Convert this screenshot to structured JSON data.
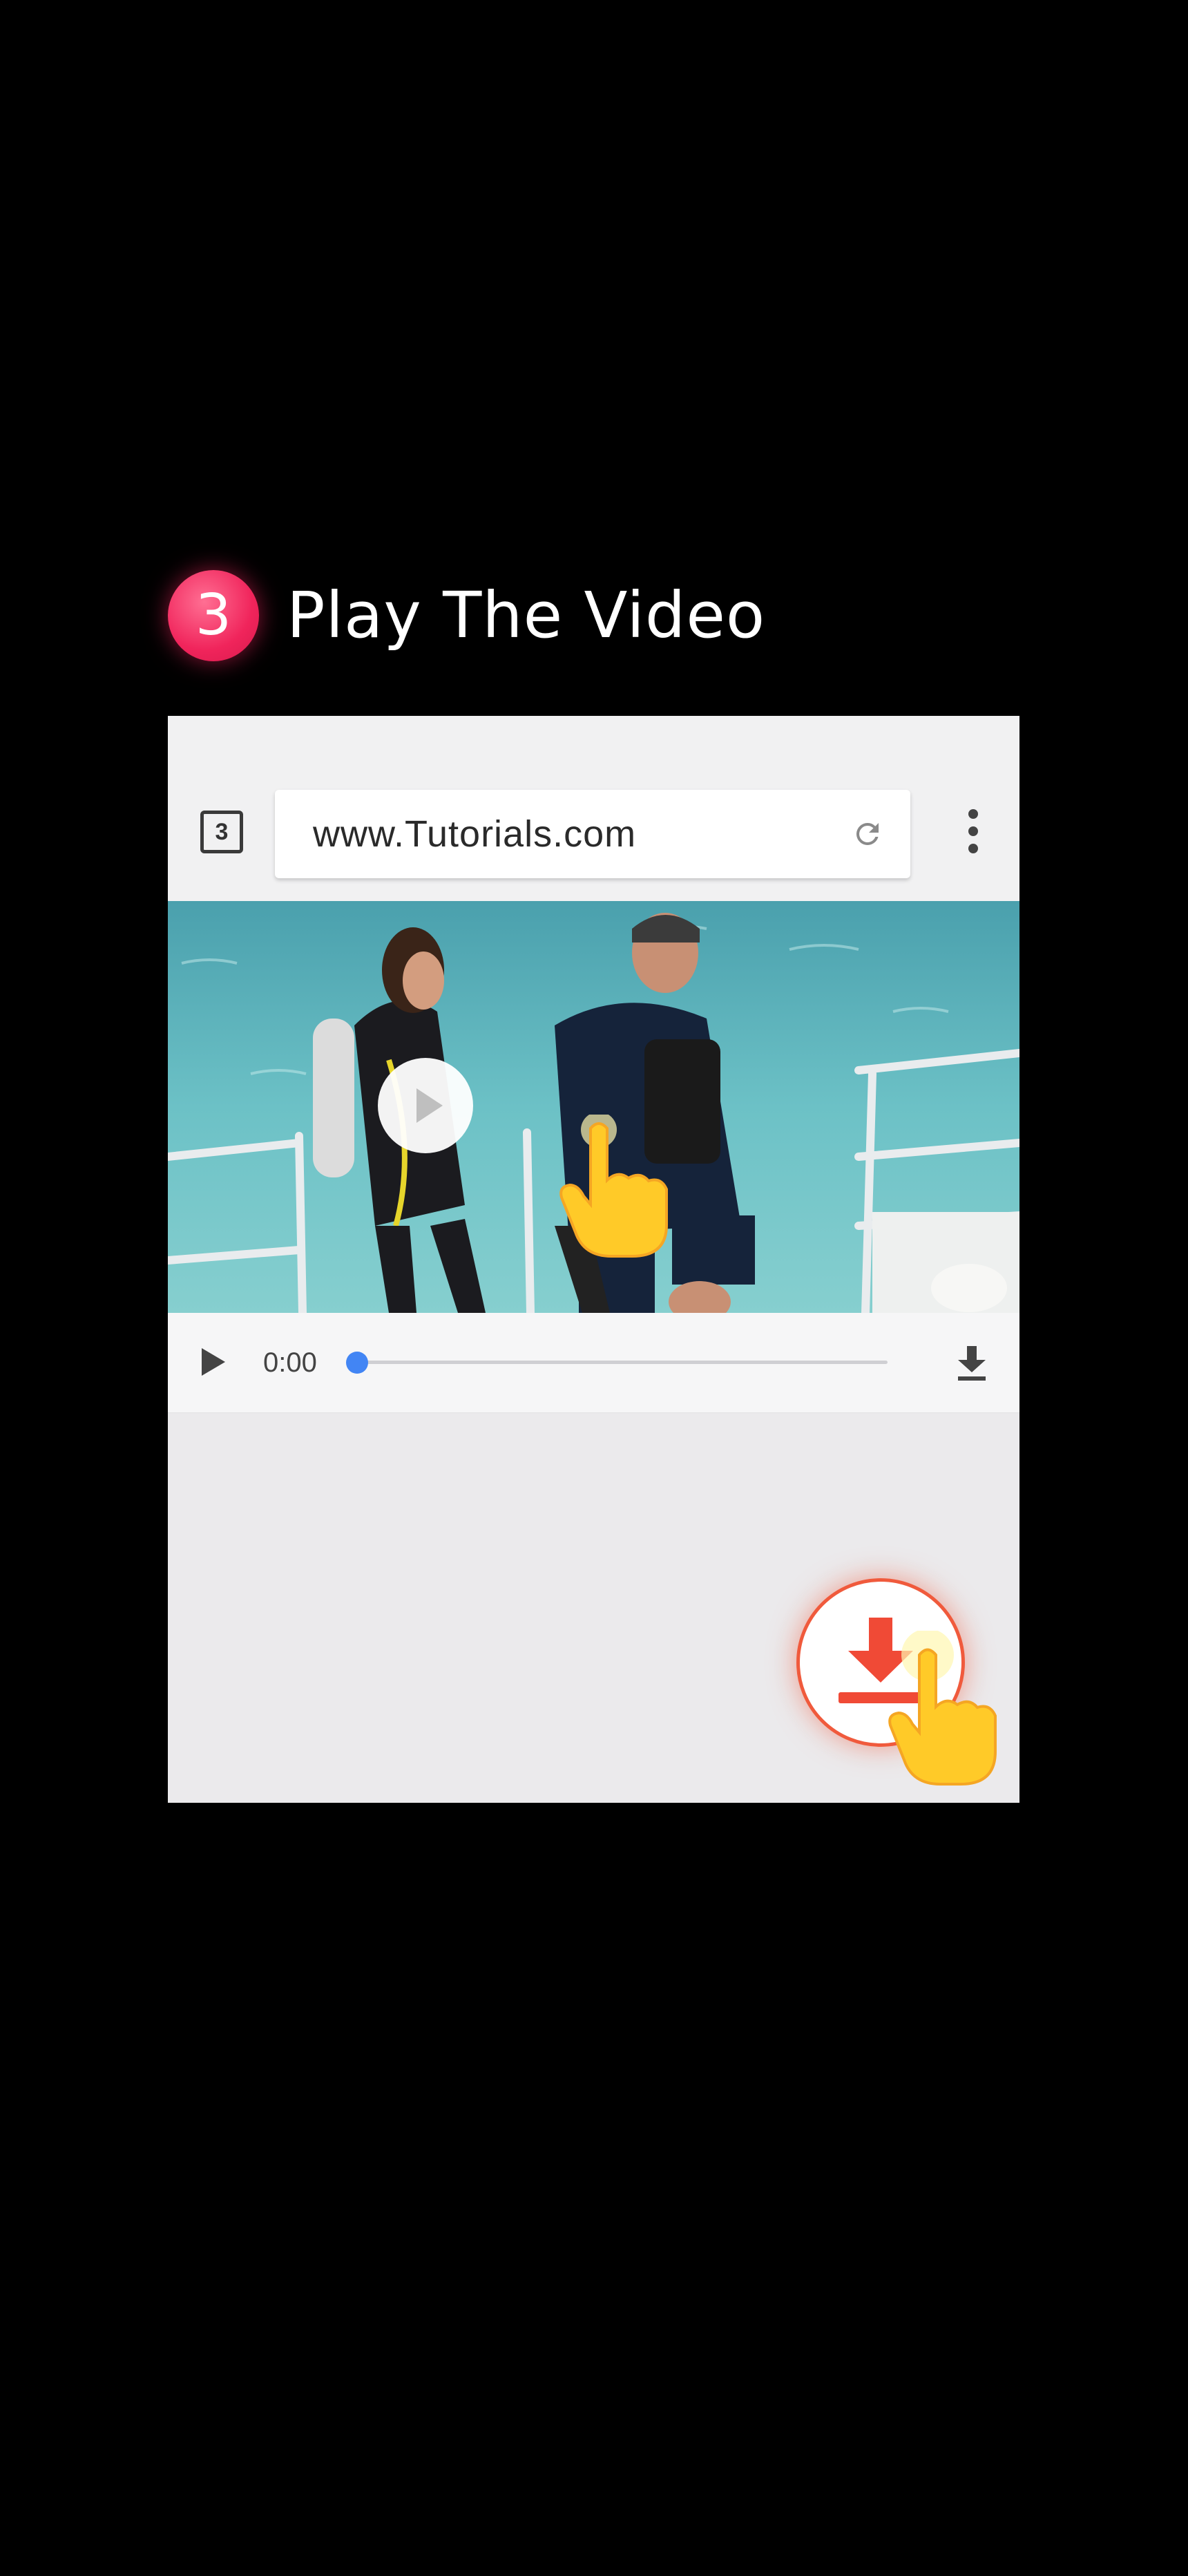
{
  "step": {
    "number": "3",
    "title": "Play The Video"
  },
  "browser": {
    "tab_count": "3",
    "url": "www.Tutorials.com",
    "reload_icon": "reload-icon",
    "menu_icon": "more-vert-icon"
  },
  "video": {
    "thumbnail_description_icon": "video-thumbnail",
    "overlay_icon": "play-icon",
    "current_time": "0:00",
    "progress": 0.0,
    "download_icon": "download-icon"
  },
  "floating_action": {
    "icon": "download-icon"
  },
  "colors": {
    "accent_pink": "#f0245b",
    "progress_blue": "#4285f4",
    "download_red": "#f05a3c",
    "hand_yellow": "#ffca28"
  }
}
